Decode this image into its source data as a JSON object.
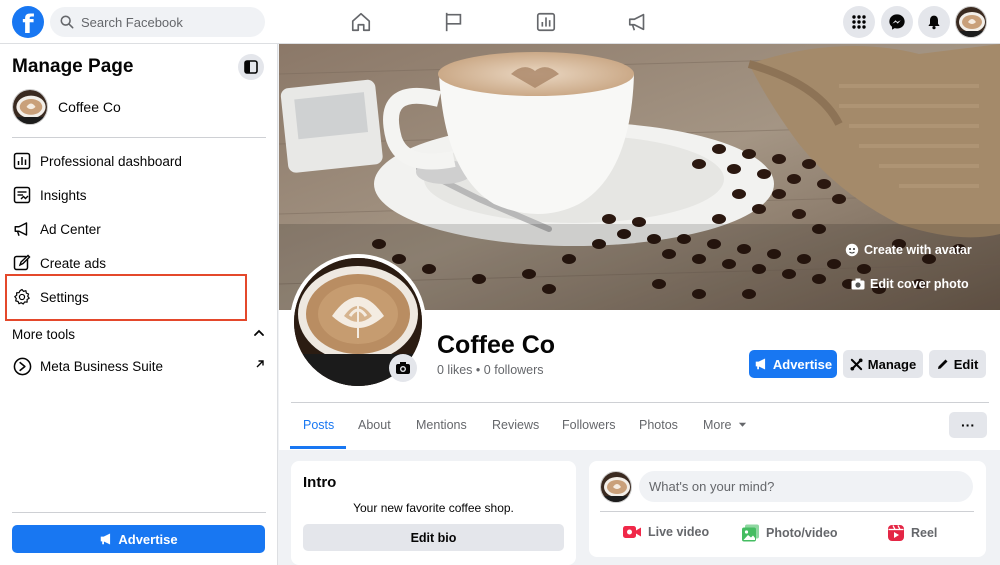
{
  "topbar": {
    "search_placeholder": "Search Facebook",
    "logo_letter": "f",
    "nav_icons": [
      "home-icon",
      "flag-icon",
      "chart-icon",
      "megaphone-icon"
    ],
    "right_icons": [
      "menu-grid-icon",
      "messenger-icon",
      "notifications-icon"
    ]
  },
  "sidebar": {
    "title": "Manage Page",
    "page_name": "Coffee Co",
    "items": [
      {
        "label": "Professional dashboard",
        "icon": "dashboard-icon"
      },
      {
        "label": "Insights",
        "icon": "insights-icon"
      },
      {
        "label": "Ad Center",
        "icon": "megaphone-icon"
      },
      {
        "label": "Create ads",
        "icon": "pencil-icon"
      },
      {
        "label": "Settings",
        "icon": "gear-icon"
      }
    ],
    "more_tools": "More tools",
    "meta_business_suite": "Meta Business Suite",
    "advertise_label": "Advertise"
  },
  "cover": {
    "create_avatar": "Create with avatar",
    "edit_cover": "Edit cover photo"
  },
  "profile": {
    "name": "Coffee Co",
    "likes": "0 likes",
    "separator": "•",
    "followers": "0 followers",
    "advertise": "Advertise",
    "manage": "Manage",
    "edit": "Edit"
  },
  "tabs": [
    "Posts",
    "About",
    "Mentions",
    "Reviews",
    "Followers",
    "Photos",
    "More"
  ],
  "tabs_more_button": "···",
  "intro": {
    "title": "Intro",
    "description": "Your new favorite coffee shop.",
    "edit_bio": "Edit bio"
  },
  "composer": {
    "placeholder": "What's on your mind?",
    "live_video": "Live video",
    "photo_video": "Photo/video",
    "reel": "Reel"
  },
  "colors": {
    "brand_blue": "#1877f2",
    "highlight_red": "#e4482b",
    "live_red": "#f02849",
    "photo_green": "#45bd62",
    "reel_red": "#e42645"
  }
}
